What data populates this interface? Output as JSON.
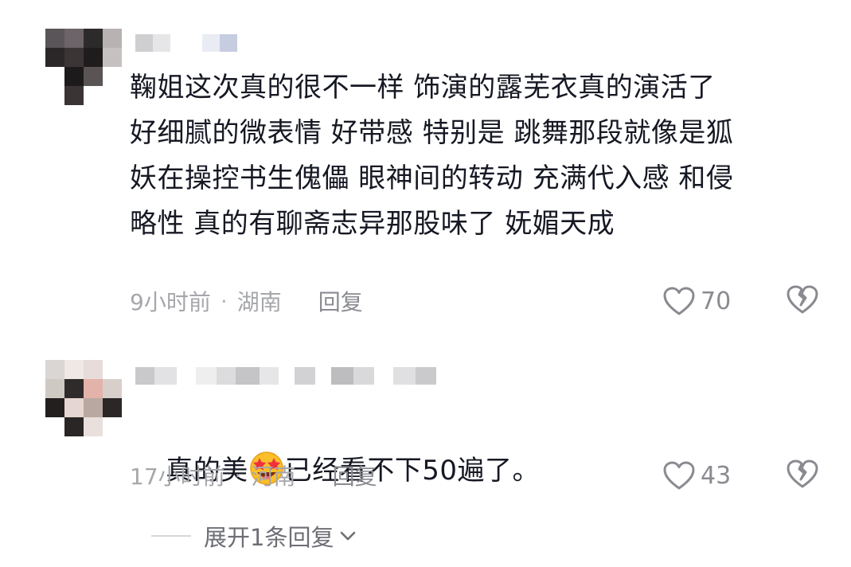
{
  "comments": [
    {
      "text": "鞠姐这次真的很不一样 饰演的露芜衣真的演活了\n好细腻的微表情 好带感 特别是 跳舞那段就像是狐\n妖在操控书生傀儡 眼神间的转动 充满代入感 和侵\n略性 真的有聊斋志异那股味了 妩媚天成",
      "time": "9小时前",
      "separator": "·",
      "location": "湖南",
      "reply_label": "回复",
      "likes": "70",
      "like_icon": "heart-outline-icon",
      "dislike_icon": "broken-heart-icon"
    },
    {
      "text_before_emoji": "真的美",
      "emoji": "star-struck-emoji",
      "text_after_emoji": "已经看不下50遍了。",
      "time": "17小时前",
      "separator": "·",
      "location": "河南",
      "reply_label": "回复",
      "likes": "43",
      "like_icon": "heart-outline-icon",
      "dislike_icon": "broken-heart-icon",
      "expand_label": "展开1条回复"
    }
  ],
  "colors": {
    "text": "#161823",
    "meta": "#a6a7ab",
    "reply": "#8a8b91",
    "expand": "#6d6e74"
  }
}
